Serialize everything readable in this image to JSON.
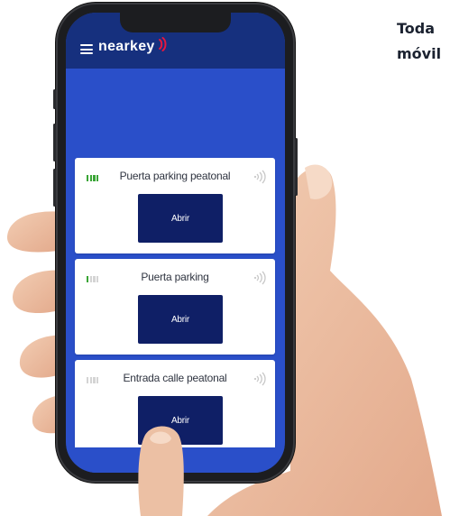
{
  "side_text": {
    "line1": "Toda",
    "line2": "móvil"
  },
  "app": {
    "brand": "nearkey",
    "menu_icon": "hamburger-menu-icon",
    "colors": {
      "header": "#16307e",
      "background": "#2a4fc9",
      "button": "#0f1f66",
      "signal_on": "#3aa536",
      "signal_off": "#d4d4d4",
      "brand_mark": "#e5173f"
    }
  },
  "doors": [
    {
      "name": "Puerta parking peatonal",
      "button_label": "Abrir",
      "signal_bars": 4,
      "signal_icon": "signal-strength-icon",
      "nfc_icon": "nfc-icon"
    },
    {
      "name": "Puerta parking",
      "button_label": "Abrir",
      "signal_bars": 1,
      "signal_icon": "signal-strength-icon",
      "nfc_icon": "nfc-icon"
    },
    {
      "name": "Entrada calle peatonal",
      "button_label": "Abrir",
      "signal_bars": 0,
      "signal_icon": "signal-strength-icon",
      "nfc_icon": "nfc-icon"
    }
  ]
}
